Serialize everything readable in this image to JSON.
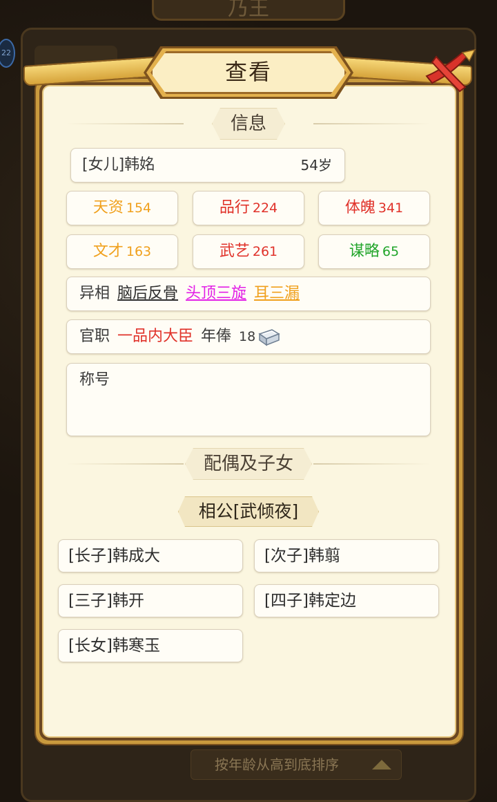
{
  "background": {
    "header_title": "乃王",
    "badge": "22",
    "sort_label": "按年龄从高到底排序"
  },
  "dialog": {
    "title": "查看",
    "close_icon": "close-x-icon"
  },
  "info_section": {
    "header": "信息",
    "name": "[女儿]韩姳",
    "age": "54岁",
    "stats": [
      {
        "label": "天资",
        "value": "154",
        "color": "#f0a01c"
      },
      {
        "label": "品行",
        "value": "224",
        "color": "#e0322a"
      },
      {
        "label": "体魄",
        "value": "341",
        "color": "#e0322a"
      },
      {
        "label": "文才",
        "value": "163",
        "color": "#f0a01c"
      },
      {
        "label": "武艺",
        "value": "261",
        "color": "#e0322a"
      },
      {
        "label": "谋略",
        "value": "65",
        "color": "#21a52a"
      }
    ],
    "traits_label": "异相",
    "traits": [
      {
        "text": "脑后反骨",
        "color": "#2e2e2e"
      },
      {
        "text": "头顶三旋",
        "color": "#e21ee6"
      },
      {
        "text": "耳三漏",
        "color": "#f0a01c"
      }
    ],
    "office_label": "官职",
    "office_value": "一品内大臣",
    "salary_label": "年俸",
    "salary_value": "18",
    "salary_icon": "silver-ingot-icon",
    "title_label": "称号"
  },
  "family_section": {
    "header": "配偶及子女",
    "spouse": "相公[武倾夜]",
    "children": [
      "[长子]韩成大",
      "[次子]韩翦",
      "[三子]韩开",
      "[四子]韩定边",
      "[长女]韩寒玉"
    ]
  }
}
